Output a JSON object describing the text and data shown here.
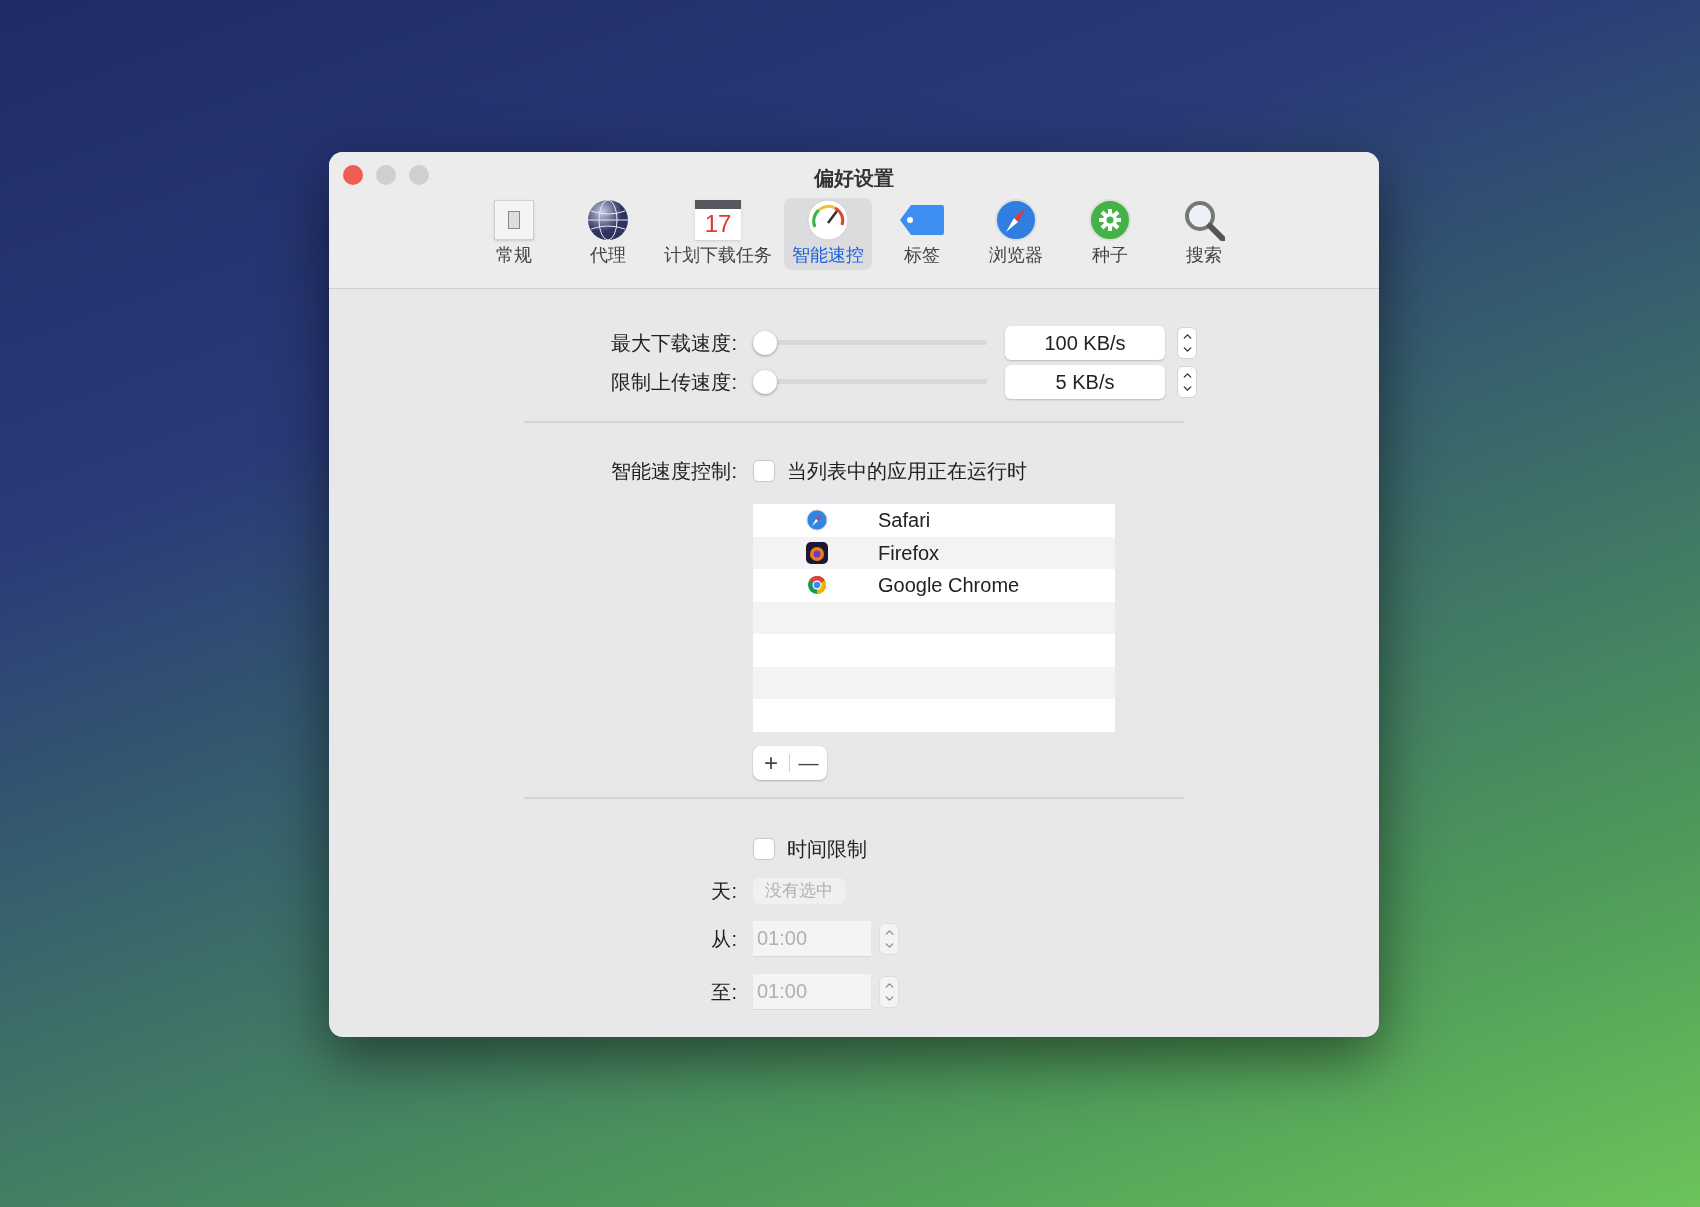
{
  "window": {
    "title": "偏好设置"
  },
  "toolbar": [
    {
      "label": "常规",
      "selected": false
    },
    {
      "label": "代理",
      "selected": false
    },
    {
      "label": "计划下载任务",
      "selected": false,
      "icon_text": "17"
    },
    {
      "label": "智能速控",
      "selected": true
    },
    {
      "label": "标签",
      "selected": false
    },
    {
      "label": "浏览器",
      "selected": false
    },
    {
      "label": "种子",
      "selected": false
    },
    {
      "label": "搜索",
      "selected": false
    }
  ],
  "speed_limits": [
    {
      "label": "最大下载速度:",
      "level": 0,
      "value": "100 KB/s"
    },
    {
      "label": "限制上传速度:",
      "level": 0,
      "value": "5 KB/s"
    }
  ],
  "smart_control": {
    "label": "智能速度控制:",
    "checkbox_label": "当列表中的应用正在运行时",
    "checked": false,
    "apps": [
      {
        "name": "Safari",
        "kind": "safari"
      },
      {
        "name": "Firefox",
        "kind": "firefox"
      },
      {
        "name": "Google Chrome",
        "kind": "chrome"
      }
    ],
    "add_button": "+",
    "remove_button": "—"
  },
  "time_limit": {
    "checkbox_label": "时间限制",
    "checked": false,
    "disabled": true,
    "day_label": "天:",
    "day_value": "没有选中",
    "from_label": "从:",
    "from_value": "01:00",
    "to_label": "至:",
    "to_value": "01:00"
  }
}
